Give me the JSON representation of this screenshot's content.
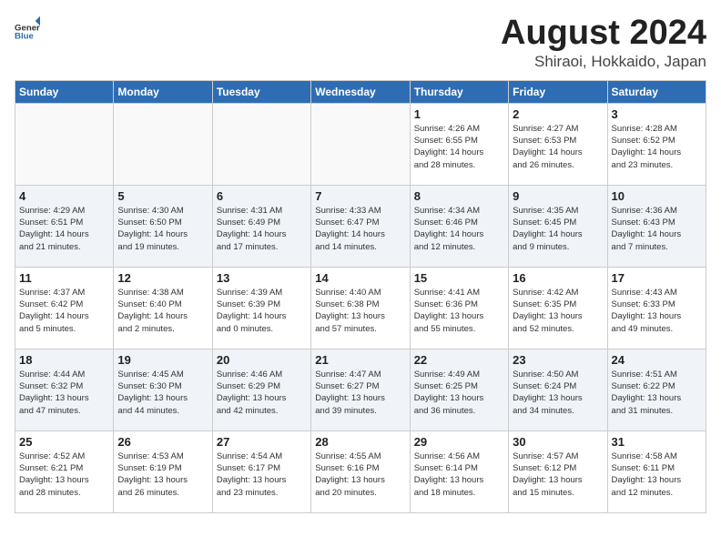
{
  "header": {
    "logo_general": "General",
    "logo_blue": "Blue",
    "month": "August 2024",
    "location": "Shiraoi, Hokkaido, Japan"
  },
  "weekdays": [
    "Sunday",
    "Monday",
    "Tuesday",
    "Wednesday",
    "Thursday",
    "Friday",
    "Saturday"
  ],
  "weeks": [
    [
      {
        "day": "",
        "info": ""
      },
      {
        "day": "",
        "info": ""
      },
      {
        "day": "",
        "info": ""
      },
      {
        "day": "",
        "info": ""
      },
      {
        "day": "1",
        "info": "Sunrise: 4:26 AM\nSunset: 6:55 PM\nDaylight: 14 hours\nand 28 minutes."
      },
      {
        "day": "2",
        "info": "Sunrise: 4:27 AM\nSunset: 6:53 PM\nDaylight: 14 hours\nand 26 minutes."
      },
      {
        "day": "3",
        "info": "Sunrise: 4:28 AM\nSunset: 6:52 PM\nDaylight: 14 hours\nand 23 minutes."
      }
    ],
    [
      {
        "day": "4",
        "info": "Sunrise: 4:29 AM\nSunset: 6:51 PM\nDaylight: 14 hours\nand 21 minutes."
      },
      {
        "day": "5",
        "info": "Sunrise: 4:30 AM\nSunset: 6:50 PM\nDaylight: 14 hours\nand 19 minutes."
      },
      {
        "day": "6",
        "info": "Sunrise: 4:31 AM\nSunset: 6:49 PM\nDaylight: 14 hours\nand 17 minutes."
      },
      {
        "day": "7",
        "info": "Sunrise: 4:33 AM\nSunset: 6:47 PM\nDaylight: 14 hours\nand 14 minutes."
      },
      {
        "day": "8",
        "info": "Sunrise: 4:34 AM\nSunset: 6:46 PM\nDaylight: 14 hours\nand 12 minutes."
      },
      {
        "day": "9",
        "info": "Sunrise: 4:35 AM\nSunset: 6:45 PM\nDaylight: 14 hours\nand 9 minutes."
      },
      {
        "day": "10",
        "info": "Sunrise: 4:36 AM\nSunset: 6:43 PM\nDaylight: 14 hours\nand 7 minutes."
      }
    ],
    [
      {
        "day": "11",
        "info": "Sunrise: 4:37 AM\nSunset: 6:42 PM\nDaylight: 14 hours\nand 5 minutes."
      },
      {
        "day": "12",
        "info": "Sunrise: 4:38 AM\nSunset: 6:40 PM\nDaylight: 14 hours\nand 2 minutes."
      },
      {
        "day": "13",
        "info": "Sunrise: 4:39 AM\nSunset: 6:39 PM\nDaylight: 14 hours\nand 0 minutes."
      },
      {
        "day": "14",
        "info": "Sunrise: 4:40 AM\nSunset: 6:38 PM\nDaylight: 13 hours\nand 57 minutes."
      },
      {
        "day": "15",
        "info": "Sunrise: 4:41 AM\nSunset: 6:36 PM\nDaylight: 13 hours\nand 55 minutes."
      },
      {
        "day": "16",
        "info": "Sunrise: 4:42 AM\nSunset: 6:35 PM\nDaylight: 13 hours\nand 52 minutes."
      },
      {
        "day": "17",
        "info": "Sunrise: 4:43 AM\nSunset: 6:33 PM\nDaylight: 13 hours\nand 49 minutes."
      }
    ],
    [
      {
        "day": "18",
        "info": "Sunrise: 4:44 AM\nSunset: 6:32 PM\nDaylight: 13 hours\nand 47 minutes."
      },
      {
        "day": "19",
        "info": "Sunrise: 4:45 AM\nSunset: 6:30 PM\nDaylight: 13 hours\nand 44 minutes."
      },
      {
        "day": "20",
        "info": "Sunrise: 4:46 AM\nSunset: 6:29 PM\nDaylight: 13 hours\nand 42 minutes."
      },
      {
        "day": "21",
        "info": "Sunrise: 4:47 AM\nSunset: 6:27 PM\nDaylight: 13 hours\nand 39 minutes."
      },
      {
        "day": "22",
        "info": "Sunrise: 4:49 AM\nSunset: 6:25 PM\nDaylight: 13 hours\nand 36 minutes."
      },
      {
        "day": "23",
        "info": "Sunrise: 4:50 AM\nSunset: 6:24 PM\nDaylight: 13 hours\nand 34 minutes."
      },
      {
        "day": "24",
        "info": "Sunrise: 4:51 AM\nSunset: 6:22 PM\nDaylight: 13 hours\nand 31 minutes."
      }
    ],
    [
      {
        "day": "25",
        "info": "Sunrise: 4:52 AM\nSunset: 6:21 PM\nDaylight: 13 hours\nand 28 minutes."
      },
      {
        "day": "26",
        "info": "Sunrise: 4:53 AM\nSunset: 6:19 PM\nDaylight: 13 hours\nand 26 minutes."
      },
      {
        "day": "27",
        "info": "Sunrise: 4:54 AM\nSunset: 6:17 PM\nDaylight: 13 hours\nand 23 minutes."
      },
      {
        "day": "28",
        "info": "Sunrise: 4:55 AM\nSunset: 6:16 PM\nDaylight: 13 hours\nand 20 minutes."
      },
      {
        "day": "29",
        "info": "Sunrise: 4:56 AM\nSunset: 6:14 PM\nDaylight: 13 hours\nand 18 minutes."
      },
      {
        "day": "30",
        "info": "Sunrise: 4:57 AM\nSunset: 6:12 PM\nDaylight: 13 hours\nand 15 minutes."
      },
      {
        "day": "31",
        "info": "Sunrise: 4:58 AM\nSunset: 6:11 PM\nDaylight: 13 hours\nand 12 minutes."
      }
    ]
  ]
}
